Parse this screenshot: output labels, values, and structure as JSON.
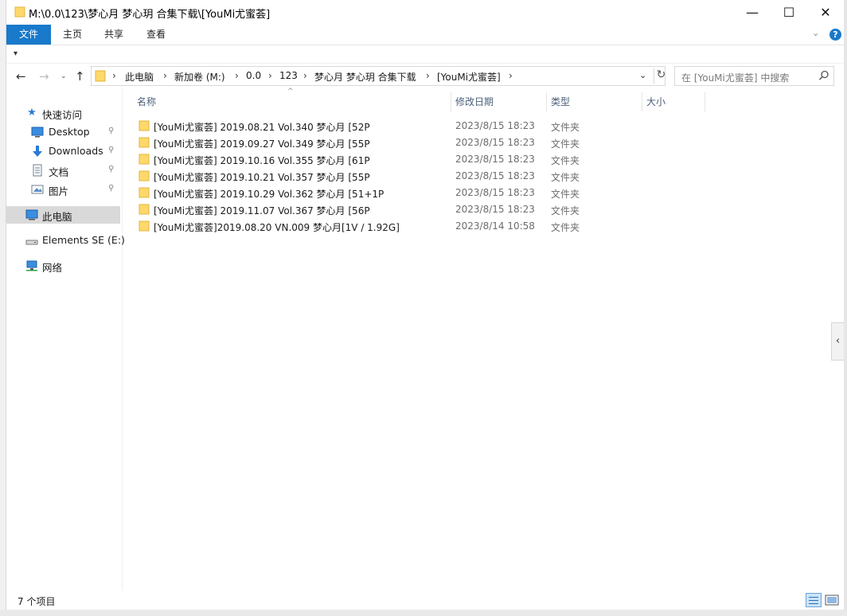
{
  "window": {
    "title": "M:\\0.0\\123\\梦心月 梦心玥 合集下载\\[YouMi尤蜜荟]",
    "controls": {
      "minimize": "—",
      "maximize": "☐",
      "close": "✕"
    }
  },
  "ribbon": {
    "tabs": [
      "文件",
      "主页",
      "共享",
      "查看"
    ],
    "expand": "⌄",
    "help": "?"
  },
  "qat": {
    "customize": "▾"
  },
  "nav": {
    "back": "←",
    "forward": "→",
    "recent": "⌄",
    "up": "↑"
  },
  "address": {
    "separator": "›",
    "crumbs": [
      "此电脑",
      "新加卷 (M:)",
      "0.0",
      "123",
      "梦心月 梦心玥 合集下载",
      "[YouMi尤蜜荟]"
    ],
    "dropdown": "⌄",
    "refresh": "↻"
  },
  "search": {
    "placeholder": "在 [YouMi尤蜜荟] 中搜索",
    "icon": "search-icon"
  },
  "navpane": {
    "quick_access": "快速访问",
    "items": [
      {
        "label": "Desktop",
        "icon": "desktop-icon",
        "pinned": true
      },
      {
        "label": "Downloads",
        "icon": "downloads-icon",
        "pinned": true
      },
      {
        "label": "文档",
        "icon": "documents-icon",
        "pinned": true
      },
      {
        "label": "图片",
        "icon": "pictures-icon",
        "pinned": true
      }
    ],
    "this_pc": "此电脑",
    "drive": "Elements SE (E:)",
    "network": "网络",
    "pin_glyph": "📌"
  },
  "columns": {
    "name": "名称",
    "date": "修改日期",
    "type": "类型",
    "size": "大小",
    "sort_glyph": "^"
  },
  "files": [
    {
      "name": "[YouMi尤蜜荟] 2019.08.21 Vol.340 梦心月 [52P",
      "date": "2023/8/15 18:23",
      "type": "文件夹"
    },
    {
      "name": "[YouMi尤蜜荟] 2019.09.27 Vol.349 梦心月 [55P",
      "date": "2023/8/15 18:23",
      "type": "文件夹"
    },
    {
      "name": "[YouMi尤蜜荟] 2019.10.16 Vol.355 梦心月 [61P",
      "date": "2023/8/15 18:23",
      "type": "文件夹"
    },
    {
      "name": "[YouMi尤蜜荟] 2019.10.21 Vol.357 梦心月 [55P",
      "date": "2023/8/15 18:23",
      "type": "文件夹"
    },
    {
      "name": "[YouMi尤蜜荟] 2019.10.29 Vol.362 梦心月 [51+1P",
      "date": "2023/8/15 18:23",
      "type": "文件夹"
    },
    {
      "name": "[YouMi尤蜜荟] 2019.11.07 Vol.367 梦心月 [56P",
      "date": "2023/8/15 18:23",
      "type": "文件夹"
    },
    {
      "name": "[YouMi尤蜜荟]2019.08.20 VN.009 梦心月[1V / 1.92G]",
      "date": "2023/8/14 10:58",
      "type": "文件夹"
    }
  ],
  "preview_toggle": "‹",
  "status": {
    "item_count": "7 个项目"
  },
  "colors": {
    "accent": "#1979ca",
    "folder": "#ffd86b",
    "selected": "#d9d9d9"
  }
}
